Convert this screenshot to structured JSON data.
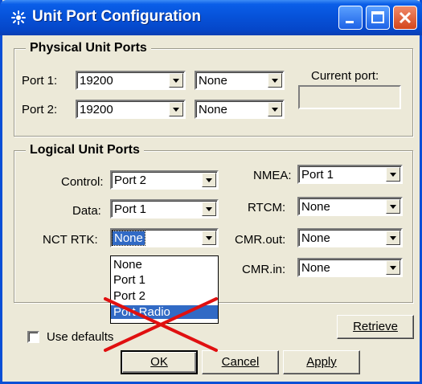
{
  "window": {
    "title": "Unit Port Configuration"
  },
  "physical": {
    "group_label": "Physical  Unit Ports",
    "port1_label": "Port 1:",
    "port1_baud": "19200",
    "port1_mode": "None",
    "port2_label": "Port 2:",
    "port2_baud": "19200",
    "port2_mode": "None",
    "current_port_label": "Current port:",
    "current_port_value": ""
  },
  "logical": {
    "group_label": "Logical Unit Ports",
    "control_label": "Control:",
    "control_value": "Port 2",
    "data_label": "Data:",
    "data_value": "Port 1",
    "ncrtk_label": "NCT RTK:",
    "ncrtk_value": "None",
    "nmea_label": "NMEA:",
    "nmea_value": "Port 1",
    "rtcm_label": "RTCM:",
    "rtcm_value": "None",
    "cmrout_label": "CMR.out:",
    "cmrout_value": "None",
    "cmrin_label": "CMR.in:",
    "cmrin_value": "None"
  },
  "dropdown": {
    "options": [
      "None",
      "Port 1",
      "Port 2",
      "Port Radio"
    ],
    "highlighted": "Port Radio"
  },
  "buttons": {
    "retrieve": "Retrieve",
    "ok": "OK",
    "cancel": "Cancel",
    "apply": "Apply"
  },
  "use_defaults": {
    "label": "Use defaults",
    "checked": false
  },
  "colors": {
    "titlebar": "#0651d8",
    "highlight": "#316ac5",
    "annotation_cross": "#e01010"
  }
}
